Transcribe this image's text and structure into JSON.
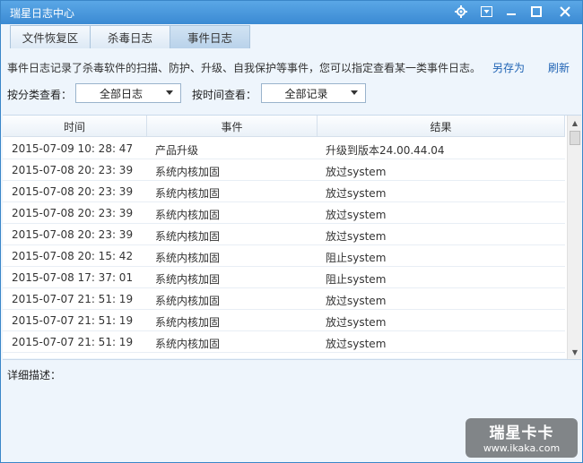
{
  "window": {
    "title": "瑞星日志中心"
  },
  "tabs": [
    {
      "label": "文件恢复区"
    },
    {
      "label": "杀毒日志"
    },
    {
      "label": "事件日志",
      "active": true
    }
  ],
  "info": {
    "text": "事件日志记录了杀毒软件的扫描、防护、升级、自我保护等事件，您可以指定查看某一类事件日志。",
    "save_as": "另存为",
    "refresh": "刷新"
  },
  "filters": {
    "category_label": "按分类查看：",
    "category_value": "全部日志",
    "time_label": "按时间查看：",
    "time_value": "全部记录"
  },
  "table": {
    "columns": [
      "时间",
      "事件",
      "结果"
    ],
    "rows": [
      [
        "2015-07-09 10: 28: 47",
        "产品升级",
        "升级到版本24.00.44.04"
      ],
      [
        "2015-07-08 20: 23: 39",
        "系统内核加固",
        "放过system"
      ],
      [
        "2015-07-08 20: 23: 39",
        "系统内核加固",
        "放过system"
      ],
      [
        "2015-07-08 20: 23: 39",
        "系统内核加固",
        "放过system"
      ],
      [
        "2015-07-08 20: 23: 39",
        "系统内核加固",
        "放过system"
      ],
      [
        "2015-07-08 20: 15: 42",
        "系统内核加固",
        "阻止system"
      ],
      [
        "2015-07-08 17: 37: 01",
        "系统内核加固",
        "阻止system"
      ],
      [
        "2015-07-07 21: 51: 19",
        "系统内核加固",
        "放过system"
      ],
      [
        "2015-07-07 21: 51: 19",
        "系统内核加固",
        "放过system"
      ],
      [
        "2015-07-07 21: 51: 19",
        "系统内核加固",
        "放过system"
      ]
    ]
  },
  "details": {
    "label": "详细描述："
  },
  "watermark": {
    "main": "瑞星卡卡",
    "sub": "www.ikaka.com"
  },
  "colors": {
    "titlebar": "#3b8ad3",
    "link": "#1f63b4",
    "background": "#eef5fc"
  }
}
